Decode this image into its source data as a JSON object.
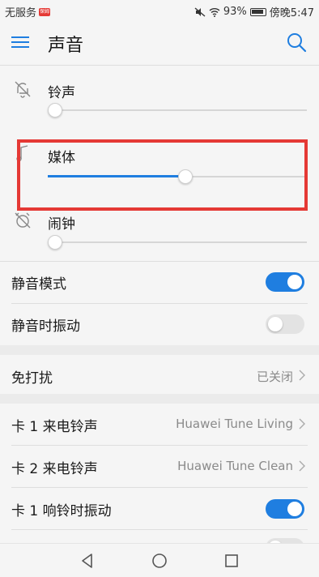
{
  "status_bar": {
    "carrier": "无服务",
    "carrier_badge": "保姆",
    "battery": "93%",
    "time": "傍晚5:47"
  },
  "header": {
    "title": "声音"
  },
  "volumes": [
    {
      "label": "铃声",
      "level": 0.0
    },
    {
      "label": "媒体",
      "level": 0.53
    },
    {
      "label": "闹钟",
      "level": 0.0
    }
  ],
  "silent_mode": {
    "label": "静音模式",
    "enabled": true
  },
  "vibrate_in_silent": {
    "label": "静音时振动",
    "enabled": false
  },
  "dnd": {
    "label": "免打扰",
    "value": "已关闭"
  },
  "sim1_ringtone": {
    "label": "卡 1 来电铃声",
    "value": "Huawei Tune Living"
  },
  "sim2_ringtone": {
    "label": "卡 2 来电铃声",
    "value": "Huawei Tune Clean"
  },
  "sim1_vibrate": {
    "label": "卡 1 响铃时振动",
    "enabled": true
  },
  "colors": {
    "accent": "#1f7ee0",
    "highlight": "#e53935"
  }
}
